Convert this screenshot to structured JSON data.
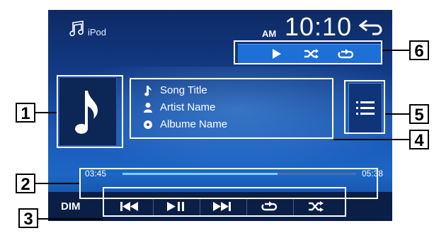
{
  "header": {
    "source_label": "iPod",
    "source_icon": "music-note-icon",
    "ampm": "AM",
    "clock": "10:10",
    "back_icon": "back-arrow-icon"
  },
  "status_icons": [
    "play-icon",
    "shuffle-icon",
    "repeat-icon"
  ],
  "track": {
    "song": "Song Title",
    "artist": "Artist Name",
    "album": "Albume Name"
  },
  "progress": {
    "elapsed": "03:45",
    "total": "05:38",
    "fraction": 0.665
  },
  "bottom_bar": {
    "dim_label": "DIM",
    "controls": [
      "previous-track-icon",
      "play-pause-icon",
      "next-track-icon",
      "repeat-icon",
      "shuffle-icon"
    ]
  },
  "callouts": [
    "1",
    "2",
    "3",
    "4",
    "5",
    "6"
  ],
  "colors": {
    "screen_dark": "#0e2a63",
    "screen_light": "#1c66c6",
    "progress_fill": "#7fd0ff"
  }
}
